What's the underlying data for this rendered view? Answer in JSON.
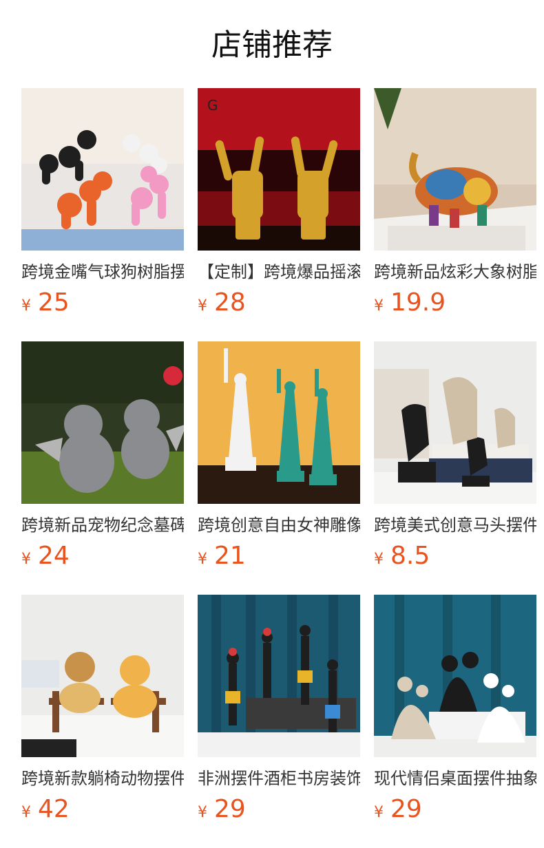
{
  "page": {
    "title": "店铺推荐"
  },
  "currency_symbol": "¥",
  "accent_color": "#e8531f",
  "products": [
    {
      "name": "跨境金嘴气球狗树脂摆件",
      "price": "25"
    },
    {
      "name": "【定制】跨境爆品摇滚手势摆件",
      "price": "28"
    },
    {
      "name": "跨境新品炫彩大象树脂摆件",
      "price": "19.9"
    },
    {
      "name": "跨境新品宠物纪念墓碑摆件",
      "price": "24"
    },
    {
      "name": "跨境创意自由女神雕像摆件",
      "price": "21"
    },
    {
      "name": "跨境美式创意马头摆件",
      "price": "8.5"
    },
    {
      "name": "跨境新款躺椅动物摆件",
      "price": "42"
    },
    {
      "name": "非洲摆件酒柜书房装饰品",
      "price": "29"
    },
    {
      "name": "现代情侣桌面摆件抽象",
      "price": "29"
    }
  ]
}
